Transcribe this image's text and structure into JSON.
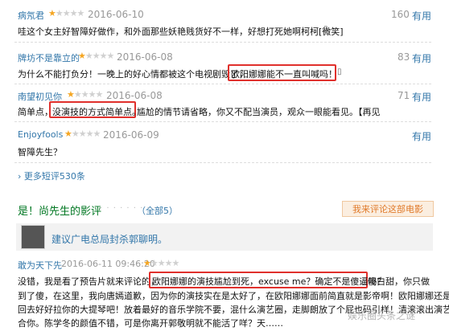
{
  "reviews": [
    {
      "user": "病氖君",
      "date": "2016-06-10",
      "count": "160",
      "useful": "有用",
      "text_plain": "哇这个女主好智障好做作，和外面那些妖艳贱货好不一样，好想打死她啊柯柯[微笑]"
    },
    {
      "user": "牌坊不是靠立的",
      "date": "2016-06-08",
      "count": "83",
      "useful": "有用",
      "text_plain": "为什么不能打负分！一晚上的好心情都被这个电视剧毁了，",
      "text_boxed": "欧阳娜娜能不一直叫喊吗！"
    },
    {
      "user": "南望初见你",
      "date": "2016-06-08",
      "count": "71",
      "useful": "有用",
      "text_plain1": "简单点，",
      "text_boxed": "没演技的方式简单点。",
      "text_plain2": "尴尬的情节请省略，你又不配当演员，观众一眼能看见。【再见"
    },
    {
      "user": "Enjoyfools",
      "date": "2016-06-09",
      "count": "",
      "useful": "有用",
      "text_plain": "智障先生？"
    }
  ],
  "more_link": "更多短评530条",
  "section": {
    "title": "是！尚先生的影评",
    "count": "（全部5）",
    "write_btn": "我来评论这部电影"
  },
  "recommend": {
    "title": "建议广电总局封杀郭聊明。"
  },
  "long_review": {
    "user": "敢为天下先",
    "date": "2016-06-11 09:46:20",
    "line1_a": "没错，我是看了预告片就来评论的，",
    "line1_box": "欧阳娜娜的演技尴尬到死，excuse me？确定不是傻逼吗？",
    "line1_b": "傻白甜，你只做",
    "line2": "到了傻，在这里，我向唐嫣道歉，因为你的演技实在是太好了，在欧阳娜娜面前简直就是影帝啊！欧阳娜娜还是",
    "line3": "回去好好拉你的大提琴吧！放着最好的音乐学院不要，混什么演艺圈，走脚朗放了个屁也码引样！清滚滚出演艺",
    "line4": "合你。陈学冬的颜值不错，可是你离开郭敬明就不能活了咩？天……"
  },
  "watermark": "娱乐圈头条之谜",
  "icons": {
    "phone": "mobile-phone-icon",
    "user": "user-icon"
  },
  "colors": {
    "link": "#3377aa",
    "star": "#f5a623",
    "highlight": "#e0302c",
    "section": "#007722"
  }
}
